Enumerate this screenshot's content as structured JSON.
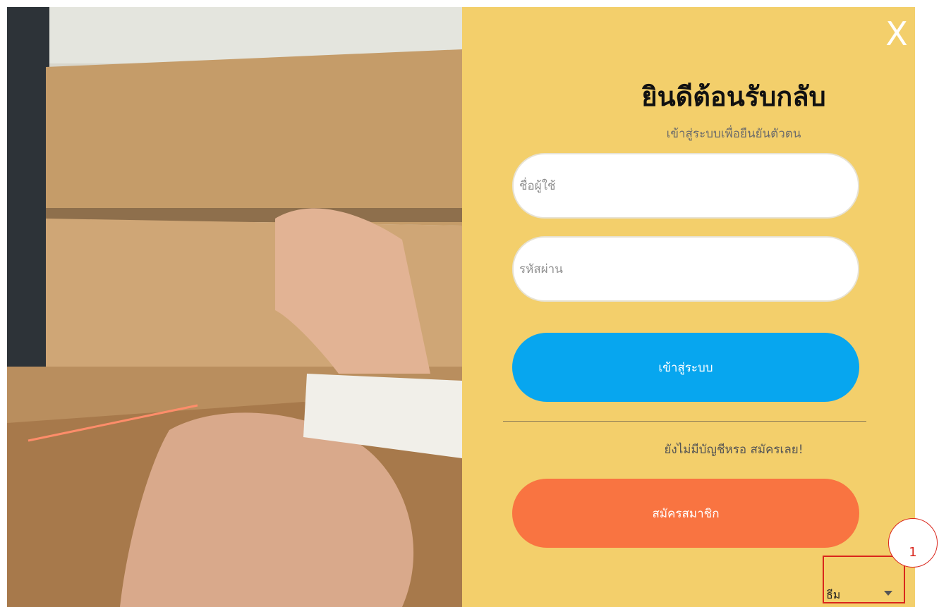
{
  "panel": {
    "close_label": "X",
    "title": "ยินดีต้อนรับกลับ",
    "subtitle": "เข้าสู่ระบบเพื่อยืนยันตัวตน",
    "username_placeholder": "ชื่อผู้ใช้",
    "password_placeholder": "รหัสผ่าน",
    "login_label": "เข้าสู่ระบบ",
    "no_account_text": "ยังไม่มีบัญชีหรอ สมัครเลย!",
    "signup_label": "สมัครสมาชิก"
  },
  "theme": {
    "label": "ธีม",
    "caret_icon": "caret-down-icon"
  },
  "annotation": {
    "number": "1"
  },
  "colors": {
    "panel_bg": "#f3cf6b",
    "login_button": "#07a6ef",
    "signup_button": "#f97441",
    "annotation": "#d9261c"
  }
}
